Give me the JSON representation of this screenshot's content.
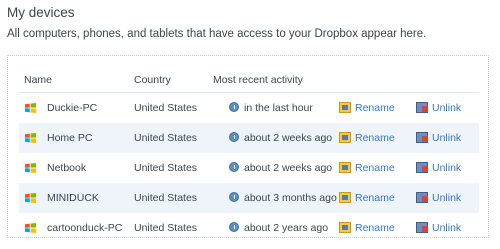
{
  "title": "My devices",
  "description": "All computers, phones, and tablets that have access to your Dropbox appear here.",
  "columns": {
    "name": "Name",
    "country": "Country",
    "activity": "Most recent activity"
  },
  "rows": [
    {
      "name": "Duckie-PC",
      "country": "United States",
      "activity": "in the last hour",
      "rename": "Rename",
      "unlink": "Unlink"
    },
    {
      "name": "Home PC",
      "country": "United States",
      "activity": "about 2 weeks ago",
      "rename": "Rename",
      "unlink": "Unlink"
    },
    {
      "name": "Netbook",
      "country": "United States",
      "activity": "about 2 weeks ago",
      "rename": "Rename",
      "unlink": "Unlink"
    },
    {
      "name": "MINIDUCK",
      "country": "United States",
      "activity": "about 3 months ago",
      "rename": "Rename",
      "unlink": "Unlink"
    },
    {
      "name": "cartoonduck-PC",
      "country": "United States",
      "activity": "about 2 years ago",
      "rename": "Rename",
      "unlink": "Unlink"
    }
  ],
  "icons": {
    "device": "windows-logo-icon",
    "activity": "clock-icon",
    "rename": "rename-icon",
    "unlink": "unlink-icon"
  },
  "colors": {
    "link": "#3378c7",
    "row_alt": "#eef4fa",
    "text": "#3d464d"
  }
}
